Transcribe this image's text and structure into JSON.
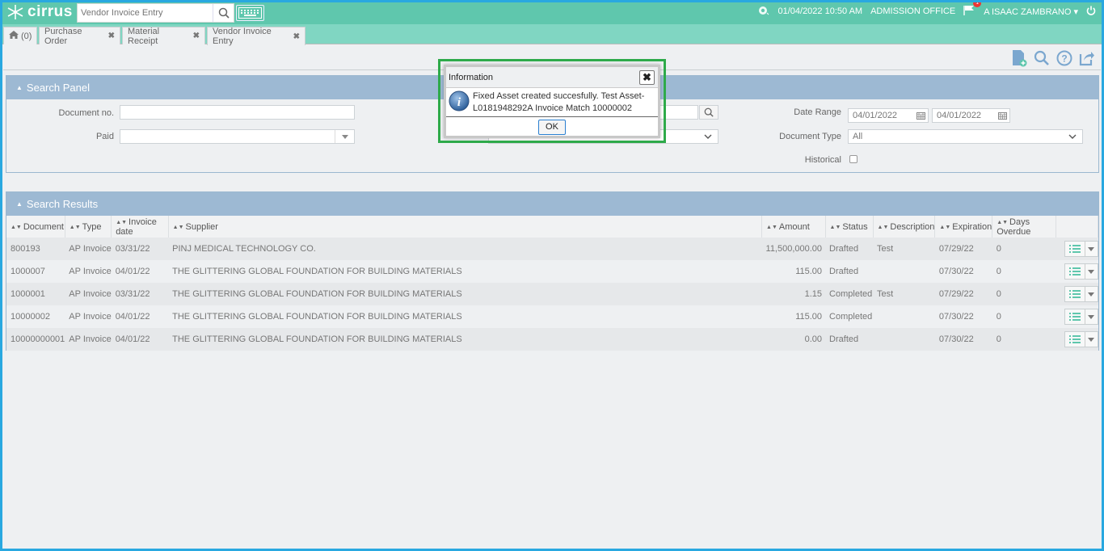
{
  "app": {
    "logo_text": "cirrus",
    "search_placeholder": "Vendor Invoice Entry"
  },
  "header": {
    "datetime": "01/04/2022 10:50 AM",
    "office": "ADMISSION OFFICE",
    "user": "A ISAAC ZAMBRANO",
    "notification_count": "1"
  },
  "tabs": [
    {
      "label": "(0)"
    },
    {
      "label": "Purchase Order"
    },
    {
      "label": "Material Receipt"
    },
    {
      "label": "Vendor Invoice Entry"
    }
  ],
  "search_panel": {
    "title": "Search Panel",
    "document_no_label": "Document no.",
    "document_no_value": "",
    "paid_label": "Paid",
    "paid_value": "",
    "date_range_label": "Date Range",
    "date_from": "04/01/2022",
    "date_to": "04/01/2022",
    "document_type_label": "Document Type",
    "document_type_value": "All",
    "historical_label": "Historical"
  },
  "results": {
    "title": "Search Results",
    "columns": [
      "Document",
      "Type",
      "Invoice date",
      "Supplier",
      "Amount",
      "Status",
      "Description",
      "Expiration",
      "Days Overdue"
    ],
    "rows": [
      {
        "document": "800193",
        "type": "AP Invoice",
        "date": "03/31/22",
        "supplier": "PINJ MEDICAL TECHNOLOGY CO.",
        "amount": "11,500,000.00",
        "status": "Drafted",
        "description": "Test",
        "expiration": "07/29/22",
        "overdue": "0"
      },
      {
        "document": "1000007",
        "type": "AP Invoice",
        "date": "04/01/22",
        "supplier": "THE GLITTERING GLOBAL FOUNDATION FOR BUILDING MATERIALS",
        "amount": "115.00",
        "status": "Drafted",
        "description": "",
        "expiration": "07/30/22",
        "overdue": "0"
      },
      {
        "document": "1000001",
        "type": "AP Invoice",
        "date": "03/31/22",
        "supplier": "THE GLITTERING GLOBAL FOUNDATION FOR BUILDING MATERIALS",
        "amount": "1.15",
        "status": "Completed",
        "description": "Test",
        "expiration": "07/29/22",
        "overdue": "0"
      },
      {
        "document": "10000002",
        "type": "AP Invoice",
        "date": "04/01/22",
        "supplier": "THE GLITTERING GLOBAL FOUNDATION FOR BUILDING MATERIALS",
        "amount": "115.00",
        "status": "Completed",
        "description": "",
        "expiration": "07/30/22",
        "overdue": "0"
      },
      {
        "document": "10000000001",
        "type": "AP Invoice",
        "date": "04/01/22",
        "supplier": "THE GLITTERING GLOBAL FOUNDATION FOR BUILDING MATERIALS",
        "amount": "0.00",
        "status": "Drafted",
        "description": "",
        "expiration": "07/30/22",
        "overdue": "0"
      }
    ]
  },
  "dialog": {
    "title": "Information",
    "message_line1": "Fixed Asset created succesfully. Test Asset-",
    "message_line2": "L0181948292A Invoice Match 10000002",
    "ok_label": "OK"
  },
  "colors": {
    "topbar": "#5fc7ad",
    "panel_header": "#9db9d3",
    "highlight": "#2eaa4a",
    "frame": "#29a8e0"
  }
}
